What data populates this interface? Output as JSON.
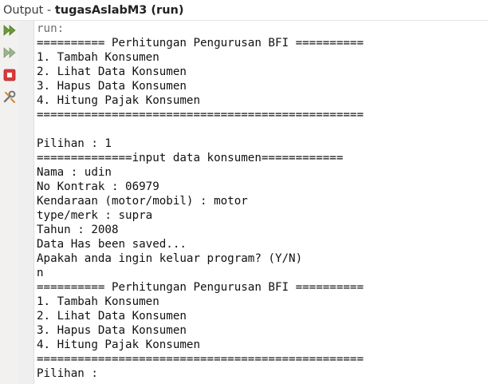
{
  "title": {
    "prefix": "Output - ",
    "project": "tugasAslabM3 (run)"
  },
  "toolbar": {
    "buttons": [
      {
        "name": "rerun-button",
        "icon": "double-play-icon",
        "color": "#6a9a3a"
      },
      {
        "name": "rerun-with-params-button",
        "icon": "double-play-icon",
        "color": "#9ab58a"
      },
      {
        "name": "stop-button",
        "icon": "stop-icon",
        "color": "#d83b3b"
      },
      {
        "name": "settings-button",
        "icon": "wrench-icon",
        "color": "#777777"
      }
    ]
  },
  "console": {
    "lines": [
      "run:",
      "========== Perhitungan Pengurusan BFI ==========",
      "1. Tambah Konsumen",
      "2. Lihat Data Konsumen",
      "3. Hapus Data Konsumen",
      "4. Hitung Pajak Konsumen",
      "================================================",
      "",
      "Pilihan : 1",
      "==============input data konsumen============",
      "Nama : udin",
      "No Kontrak : 06979",
      "Kendaraan (motor/mobil) : motor",
      "type/merk : supra",
      "Tahun : 2008",
      "Data Has been saved...",
      "Apakah anda ingin keluar program? (Y/N)",
      "n",
      "========== Perhitungan Pengurusan BFI ==========",
      "1. Tambah Konsumen",
      "2. Lihat Data Konsumen",
      "3. Hapus Data Konsumen",
      "4. Hitung Pajak Konsumen",
      "================================================",
      "Pilihan : "
    ]
  }
}
